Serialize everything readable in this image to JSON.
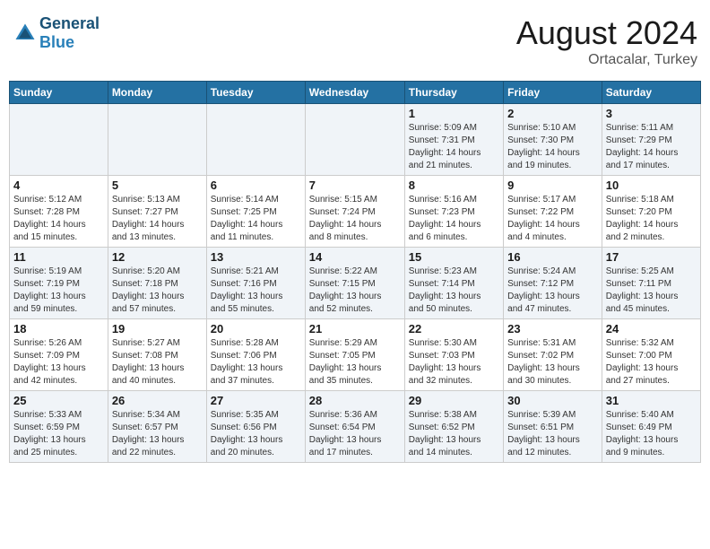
{
  "header": {
    "logo_line1": "General",
    "logo_line2": "Blue",
    "month": "August 2024",
    "location": "Ortacalar, Turkey"
  },
  "weekdays": [
    "Sunday",
    "Monday",
    "Tuesday",
    "Wednesday",
    "Thursday",
    "Friday",
    "Saturday"
  ],
  "weeks": [
    [
      {
        "day": "",
        "info": ""
      },
      {
        "day": "",
        "info": ""
      },
      {
        "day": "",
        "info": ""
      },
      {
        "day": "",
        "info": ""
      },
      {
        "day": "1",
        "info": "Sunrise: 5:09 AM\nSunset: 7:31 PM\nDaylight: 14 hours\nand 21 minutes."
      },
      {
        "day": "2",
        "info": "Sunrise: 5:10 AM\nSunset: 7:30 PM\nDaylight: 14 hours\nand 19 minutes."
      },
      {
        "day": "3",
        "info": "Sunrise: 5:11 AM\nSunset: 7:29 PM\nDaylight: 14 hours\nand 17 minutes."
      }
    ],
    [
      {
        "day": "4",
        "info": "Sunrise: 5:12 AM\nSunset: 7:28 PM\nDaylight: 14 hours\nand 15 minutes."
      },
      {
        "day": "5",
        "info": "Sunrise: 5:13 AM\nSunset: 7:27 PM\nDaylight: 14 hours\nand 13 minutes."
      },
      {
        "day": "6",
        "info": "Sunrise: 5:14 AM\nSunset: 7:25 PM\nDaylight: 14 hours\nand 11 minutes."
      },
      {
        "day": "7",
        "info": "Sunrise: 5:15 AM\nSunset: 7:24 PM\nDaylight: 14 hours\nand 8 minutes."
      },
      {
        "day": "8",
        "info": "Sunrise: 5:16 AM\nSunset: 7:23 PM\nDaylight: 14 hours\nand 6 minutes."
      },
      {
        "day": "9",
        "info": "Sunrise: 5:17 AM\nSunset: 7:22 PM\nDaylight: 14 hours\nand 4 minutes."
      },
      {
        "day": "10",
        "info": "Sunrise: 5:18 AM\nSunset: 7:20 PM\nDaylight: 14 hours\nand 2 minutes."
      }
    ],
    [
      {
        "day": "11",
        "info": "Sunrise: 5:19 AM\nSunset: 7:19 PM\nDaylight: 13 hours\nand 59 minutes."
      },
      {
        "day": "12",
        "info": "Sunrise: 5:20 AM\nSunset: 7:18 PM\nDaylight: 13 hours\nand 57 minutes."
      },
      {
        "day": "13",
        "info": "Sunrise: 5:21 AM\nSunset: 7:16 PM\nDaylight: 13 hours\nand 55 minutes."
      },
      {
        "day": "14",
        "info": "Sunrise: 5:22 AM\nSunset: 7:15 PM\nDaylight: 13 hours\nand 52 minutes."
      },
      {
        "day": "15",
        "info": "Sunrise: 5:23 AM\nSunset: 7:14 PM\nDaylight: 13 hours\nand 50 minutes."
      },
      {
        "day": "16",
        "info": "Sunrise: 5:24 AM\nSunset: 7:12 PM\nDaylight: 13 hours\nand 47 minutes."
      },
      {
        "day": "17",
        "info": "Sunrise: 5:25 AM\nSunset: 7:11 PM\nDaylight: 13 hours\nand 45 minutes."
      }
    ],
    [
      {
        "day": "18",
        "info": "Sunrise: 5:26 AM\nSunset: 7:09 PM\nDaylight: 13 hours\nand 42 minutes."
      },
      {
        "day": "19",
        "info": "Sunrise: 5:27 AM\nSunset: 7:08 PM\nDaylight: 13 hours\nand 40 minutes."
      },
      {
        "day": "20",
        "info": "Sunrise: 5:28 AM\nSunset: 7:06 PM\nDaylight: 13 hours\nand 37 minutes."
      },
      {
        "day": "21",
        "info": "Sunrise: 5:29 AM\nSunset: 7:05 PM\nDaylight: 13 hours\nand 35 minutes."
      },
      {
        "day": "22",
        "info": "Sunrise: 5:30 AM\nSunset: 7:03 PM\nDaylight: 13 hours\nand 32 minutes."
      },
      {
        "day": "23",
        "info": "Sunrise: 5:31 AM\nSunset: 7:02 PM\nDaylight: 13 hours\nand 30 minutes."
      },
      {
        "day": "24",
        "info": "Sunrise: 5:32 AM\nSunset: 7:00 PM\nDaylight: 13 hours\nand 27 minutes."
      }
    ],
    [
      {
        "day": "25",
        "info": "Sunrise: 5:33 AM\nSunset: 6:59 PM\nDaylight: 13 hours\nand 25 minutes."
      },
      {
        "day": "26",
        "info": "Sunrise: 5:34 AM\nSunset: 6:57 PM\nDaylight: 13 hours\nand 22 minutes."
      },
      {
        "day": "27",
        "info": "Sunrise: 5:35 AM\nSunset: 6:56 PM\nDaylight: 13 hours\nand 20 minutes."
      },
      {
        "day": "28",
        "info": "Sunrise: 5:36 AM\nSunset: 6:54 PM\nDaylight: 13 hours\nand 17 minutes."
      },
      {
        "day": "29",
        "info": "Sunrise: 5:38 AM\nSunset: 6:52 PM\nDaylight: 13 hours\nand 14 minutes."
      },
      {
        "day": "30",
        "info": "Sunrise: 5:39 AM\nSunset: 6:51 PM\nDaylight: 13 hours\nand 12 minutes."
      },
      {
        "day": "31",
        "info": "Sunrise: 5:40 AM\nSunset: 6:49 PM\nDaylight: 13 hours\nand 9 minutes."
      }
    ]
  ]
}
